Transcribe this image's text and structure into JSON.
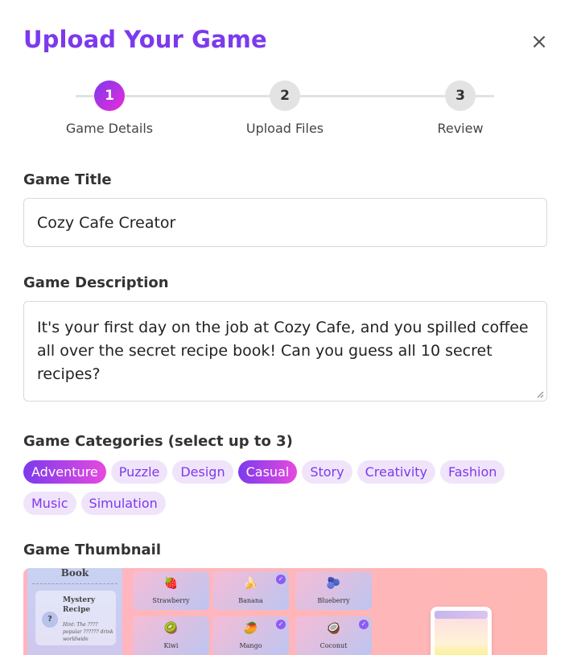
{
  "modal": {
    "title": "Upload Your Game",
    "close_symbol": "×"
  },
  "stepper": {
    "steps": [
      {
        "number": "1",
        "label": "Game Details",
        "active": true
      },
      {
        "number": "2",
        "label": "Upload Files",
        "active": false
      },
      {
        "number": "3",
        "label": "Review",
        "active": false
      }
    ]
  },
  "form": {
    "title_label": "Game Title",
    "title_value": "Cozy Cafe Creator",
    "description_label": "Game Description",
    "description_value": "It's your first day on the job at Cozy Cafe, and you spilled coffee all over the secret recipe book! Can you guess all 10 secret recipes?",
    "categories_label": "Game Categories (select up to 3)",
    "categories": [
      {
        "label": "Adventure",
        "selected": true
      },
      {
        "label": "Puzzle",
        "selected": false
      },
      {
        "label": "Design",
        "selected": false
      },
      {
        "label": "Casual",
        "selected": true
      },
      {
        "label": "Story",
        "selected": false
      },
      {
        "label": "Creativity",
        "selected": false
      },
      {
        "label": "Fashion",
        "selected": false
      },
      {
        "label": "Music",
        "selected": false
      },
      {
        "label": "Simulation",
        "selected": false
      }
    ],
    "thumbnail_label": "Game Thumbnail"
  },
  "thumbnail": {
    "book_title": "Book",
    "recipe_symbol": "?",
    "recipe_name": "Mystery Recipe",
    "recipe_hint": "Hint: The ???? popular ?????? drink worldwide",
    "ingredients": [
      {
        "name": "Strawberry",
        "icon": "🍓",
        "checked": false
      },
      {
        "name": "Banana",
        "icon": "🍌",
        "checked": true
      },
      {
        "name": "Blueberry",
        "icon": "🫐",
        "checked": false
      },
      {
        "name": "Kiwi",
        "icon": "🥝",
        "checked": false
      },
      {
        "name": "Mango",
        "icon": "🥭",
        "checked": true
      },
      {
        "name": "Coconut",
        "icon": "🥥",
        "checked": true
      }
    ],
    "check_symbol": "✓",
    "colors": {
      "accent": "#7c3aed",
      "gradient_end": "#ec2bd8",
      "chip_bg": "#f0e4fb"
    }
  }
}
